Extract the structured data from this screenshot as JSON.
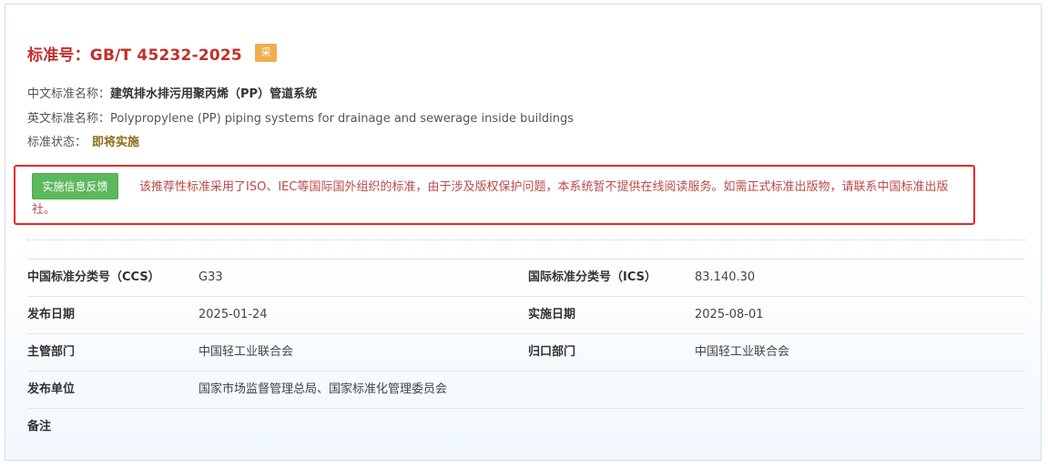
{
  "header": {
    "title": "标准号：GB/T 45232-2025",
    "badge": "采"
  },
  "info": {
    "cn_name_label": "中文标准名称：",
    "cn_name": "建筑排水排污用聚丙烯（PP）管道系统",
    "en_name_label": "英文标准名称：",
    "en_name": "Polypropylene (PP) piping systems for drainage and sewerage inside buildings",
    "status_label": "标准状态：",
    "status": "即将实施"
  },
  "notice": {
    "button_label": "实施信息反馈",
    "text": "该推荐性标准采用了ISO、IEC等国际国外组织的标准，由于涉及版权保护问题，本系统暂不提供在线阅读服务。如需正式标准出版物，请联系中国标准出版社。"
  },
  "details": {
    "rows": [
      {
        "k1": "中国标准分类号（CCS）",
        "v1": "G33",
        "k2": "国际标准分类号（ICS）",
        "v2": "83.140.30"
      },
      {
        "k1": "发布日期",
        "v1": "2025-01-24",
        "k2": "实施日期",
        "v2": "2025-08-01"
      },
      {
        "k1": "主管部门",
        "v1": "中国轻工业联合会",
        "k2": "归口部门",
        "v2": "中国轻工业联合会"
      },
      {
        "k1": "发布单位",
        "v1": "国家市场监督管理总局、国家标准化管理委员会",
        "k2": "",
        "v2": ""
      },
      {
        "k1": "备注",
        "v1": "",
        "k2": "",
        "v2": ""
      }
    ]
  },
  "colors": {
    "title": "#c0302a",
    "badge": "#f0ad4e",
    "feedback_button": "#5cb85c",
    "notice_border": "#e8262a",
    "notice_text": "#b94a48",
    "status": "#8a6d1a"
  }
}
